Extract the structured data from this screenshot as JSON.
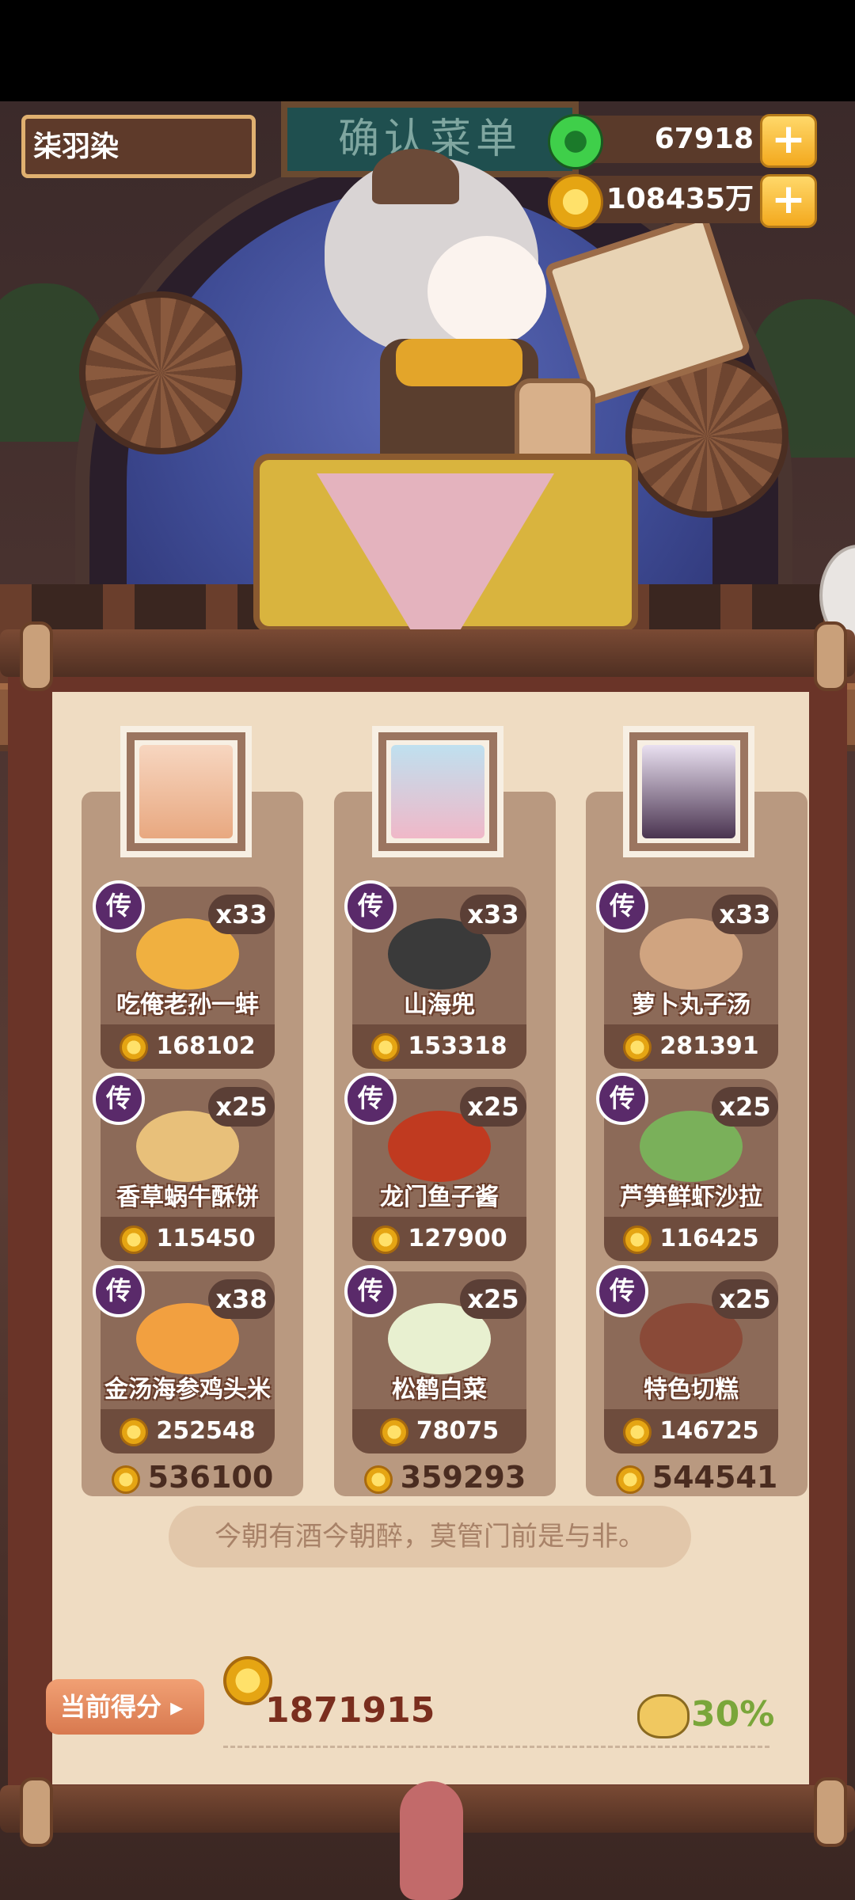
{
  "hud": {
    "player_name": "柒羽染",
    "jade_amount": "67918",
    "coin_amount": "108435万",
    "plus_label": "+"
  },
  "banner": {
    "title": "确认菜单"
  },
  "columns": [
    {
      "total": "536100",
      "dishes": [
        {
          "rank": "传",
          "count": "x33",
          "name": "吃俺老孙一蚌",
          "price": "168102"
        },
        {
          "rank": "传",
          "count": "x25",
          "name": "香草蜗牛酥饼",
          "price": "115450"
        },
        {
          "rank": "传",
          "count": "x38",
          "name": "金汤海参鸡头米",
          "price": "252548"
        }
      ]
    },
    {
      "total": "359293",
      "dishes": [
        {
          "rank": "传",
          "count": "x33",
          "name": "山海兜",
          "price": "153318"
        },
        {
          "rank": "传",
          "count": "x25",
          "name": "龙门鱼子酱",
          "price": "127900"
        },
        {
          "rank": "传",
          "count": "x25",
          "name": "松鹤白菜",
          "price": "78075"
        }
      ]
    },
    {
      "total": "544541",
      "dishes": [
        {
          "rank": "传",
          "count": "x33",
          "name": "萝卜丸子汤",
          "price": "281391"
        },
        {
          "rank": "传",
          "count": "x25",
          "name": "芦笋鲜虾沙拉",
          "price": "116425"
        },
        {
          "rank": "传",
          "count": "x25",
          "name": "特色切糕",
          "price": "146725"
        }
      ]
    }
  ],
  "quote": "今朝有酒今朝醉，莫管门前是与非。",
  "score": {
    "label": "当前得分",
    "value": "1871915",
    "bonus": "30%"
  },
  "colors": {
    "accent_gold": "#f3a91e",
    "badge_purple": "#5a2a6a",
    "bonus_green": "#7aa63a"
  }
}
